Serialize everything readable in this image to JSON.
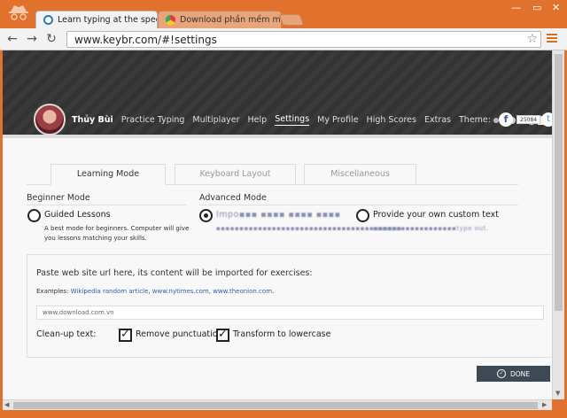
{
  "browser": {
    "tabs": [
      {
        "title": "Learn typing at the speed",
        "active": true
      },
      {
        "title": "Download phần mềm miễ",
        "active": false
      }
    ],
    "url": "www.keybr.com/#!settings"
  },
  "site": {
    "user_name": "Thủy Bùi",
    "nav": [
      "Practice Typing",
      "Multiplayer",
      "Help",
      "Settings",
      "My Profile",
      "High Scores",
      "Extras",
      "Theme:"
    ],
    "active_nav": "Settings",
    "fb_count": "25084",
    "fb_glyph": "f",
    "tw_glyph": "t"
  },
  "settings": {
    "tabs": [
      "Learning Mode",
      "Keyboard Layout",
      "Miscellaneous"
    ],
    "active_tab": "Learning Mode",
    "beginner_mode": {
      "heading": "Beginner Mode",
      "option": "Guided Lessons",
      "description_line1": "A best mode for beginners. Computer will give",
      "description_line2": "you lessons matching your skills."
    },
    "advanced_mode": {
      "heading": "Advanced Mode",
      "option1": "Impo▪▪▪ ▪▪▪▪ ▪▪▪▪ ▪▪▪▪",
      "option1_desc": "▪▪▪▪▪▪▪▪▪▪▪▪▪▪▪▪▪▪▪▪▪▪▪▪▪▪▪▪▪▪▪▪▪▪▪▪▪▪▪▪",
      "option2": "Provide your own custom text",
      "option2_desc": "▪▪▪▪▪▪▪▪▪▪▪▪▪▪▪▪▪▪type out."
    },
    "import": {
      "title": "Paste web site url here, its content will be imported for exercises:",
      "examples_label": "Examples: ",
      "examples": [
        "Wikipedia random article",
        "www.nytimes.com",
        "www.theonion.com"
      ],
      "url_value": "www.download.com.vn",
      "cleanup_label": "Clean-up text:",
      "remove_punctuation": "Remove punctuation",
      "lowercase": "Transform to lowercase"
    },
    "done_label": "DONE"
  },
  "colors": {
    "chrome_frame": "#e0722d",
    "done_button": "#3d4a55",
    "link": "#2b5fb3"
  }
}
